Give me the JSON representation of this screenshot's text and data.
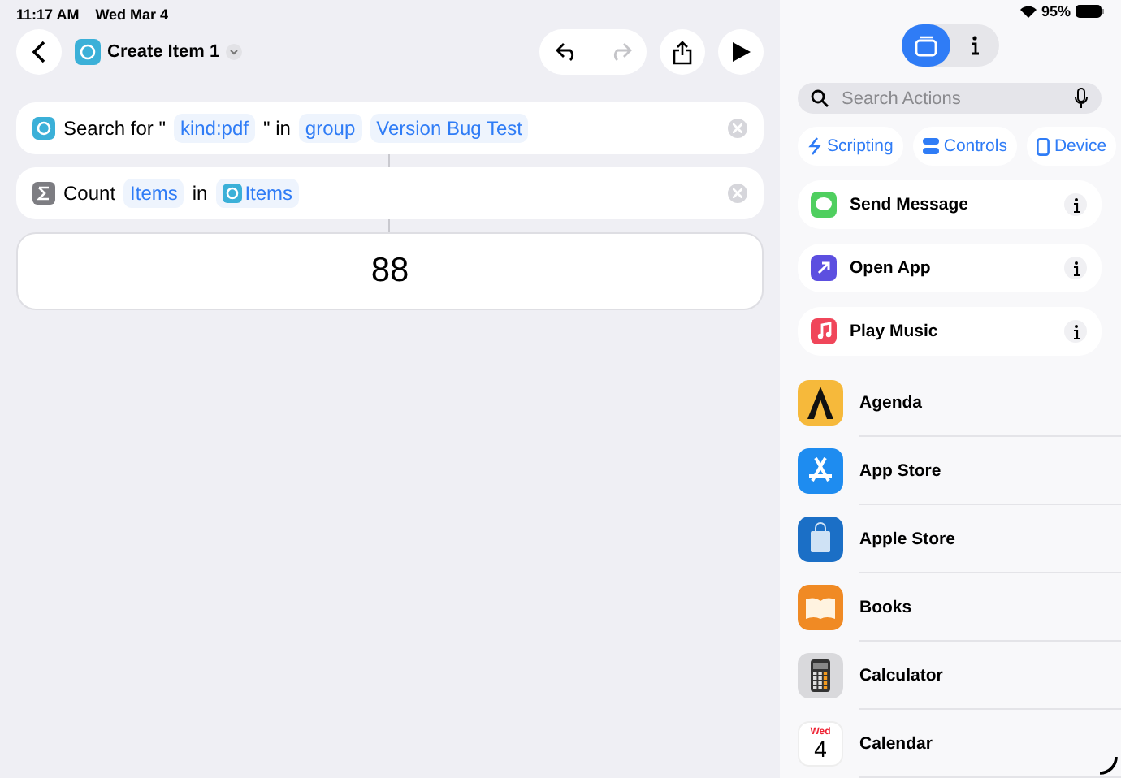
{
  "status_bar": {
    "time": "11:17 AM",
    "date": "Wed Mar 4",
    "battery": "95%"
  },
  "toolbar": {
    "title": "Create Item 1",
    "redo_disabled": true
  },
  "steps": [
    {
      "kind": "shortcuts",
      "parts": [
        {
          "kind": "text",
          "text": "Search for \""
        },
        {
          "kind": "token",
          "text": "kind:pdf"
        },
        {
          "kind": "text",
          "text": "\" in"
        },
        {
          "kind": "token",
          "text": "group"
        },
        {
          "kind": "token",
          "text": "Version Bug Test"
        }
      ]
    },
    {
      "kind": "sigma",
      "parts": [
        {
          "kind": "text",
          "text": "Count"
        },
        {
          "kind": "token",
          "text": "Items"
        },
        {
          "kind": "text",
          "text": "in"
        },
        {
          "kind": "variable",
          "text": "Items"
        }
      ]
    }
  ],
  "result": "88",
  "panel": {
    "segments": [
      {
        "kind": "library",
        "selected": true
      },
      {
        "kind": "info",
        "selected": false
      }
    ],
    "search": {
      "placeholder": "Search Actions"
    },
    "categories": [
      {
        "kind": "scripting",
        "label": "Scripting"
      },
      {
        "kind": "controls",
        "label": "Controls"
      },
      {
        "kind": "device",
        "label": "Device"
      }
    ],
    "suggestions": [
      {
        "kind": "message",
        "label": "Send Message"
      },
      {
        "kind": "openapp",
        "label": "Open App"
      },
      {
        "kind": "music",
        "label": "Play Music"
      }
    ],
    "apps": [
      {
        "kind": "agenda",
        "label": "Agenda"
      },
      {
        "kind": "appstore",
        "label": "App Store"
      },
      {
        "kind": "applestore",
        "label": "Apple Store"
      },
      {
        "kind": "books",
        "label": "Books"
      },
      {
        "kind": "calculator",
        "label": "Calculator"
      },
      {
        "kind": "calendar",
        "label": "Calendar",
        "icon_day": "Wed",
        "icon_date": "4"
      }
    ]
  }
}
